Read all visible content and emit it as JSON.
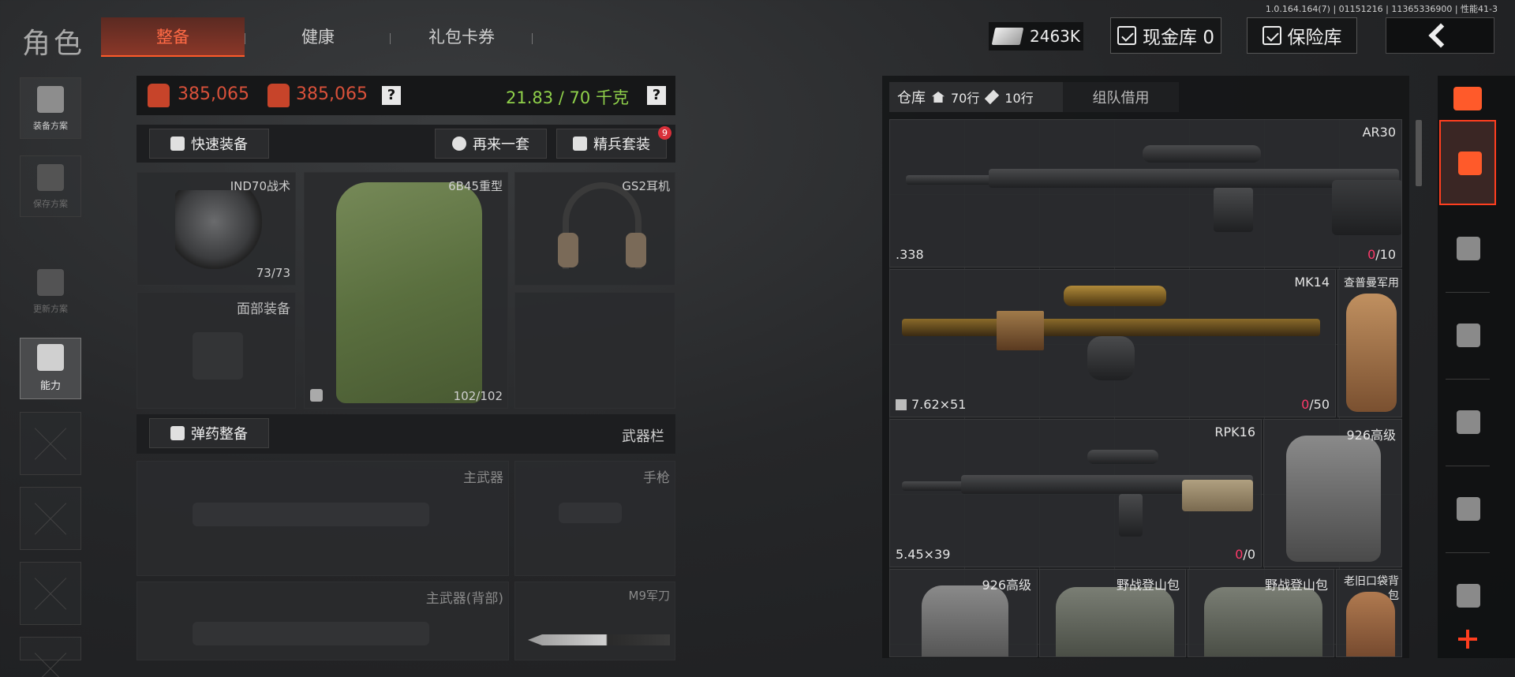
{
  "version": "1.0.164.164(7) | 01151216 | 11365336900 | 性能41-3",
  "page_title": "角色",
  "tabs": [
    {
      "label": "整备",
      "active": true
    },
    {
      "label": "健康",
      "active": false
    },
    {
      "label": "礼包卡券",
      "active": false
    }
  ],
  "currency": {
    "amount": "2463K"
  },
  "top_buttons": {
    "cash_vault": "现金库 0",
    "insurance": "保险库"
  },
  "sidebar": {
    "items": [
      {
        "label": "装备方案",
        "icon": "vest-icon"
      },
      {
        "label": "保存方案",
        "icon": "download-icon"
      },
      {
        "label": "更新方案",
        "icon": "helmet-icon"
      },
      {
        "label": "能力",
        "icon": "lightning-icon"
      }
    ]
  },
  "loadout": {
    "value_1": "385,065",
    "value_2": "385,065",
    "weight": "21.83 / 70 千克",
    "help": "?"
  },
  "actions": {
    "quick_equip": "快速装备",
    "again": "再来一套",
    "elite": "精兵套装",
    "elite_badge": "9",
    "ammo": "弹药整备",
    "weapon_bar": "武器栏"
  },
  "slots": {
    "helmet": {
      "name": "IND70战术",
      "durability": "73/73"
    },
    "armor": {
      "name": "6B45重型",
      "durability": "102/102"
    },
    "headset": {
      "name": "GS2耳机"
    },
    "face": {
      "name": "面部装备"
    },
    "primary": {
      "name": "主武器"
    },
    "pistol": {
      "name": "手枪"
    },
    "primary_back": {
      "name": "主武器(背部)"
    },
    "melee": {
      "name": "M9军刀"
    }
  },
  "warehouse": {
    "tab_label": "仓库",
    "rows_1": "70行",
    "rows_2": "10行",
    "team_tab": "组队借用",
    "items": [
      {
        "name": "AR30",
        "caliber": ".338",
        "ammo_loaded": "0",
        "ammo_total": "/10"
      },
      {
        "name": "MK14",
        "caliber": "7.62×51",
        "ammo_loaded": "0",
        "ammo_total": "/50"
      },
      {
        "name": "查普曼军用"
      },
      {
        "name": "RPK16",
        "caliber": "5.45×39",
        "ammo_loaded": "0",
        "ammo_total": "/0"
      },
      {
        "name": "926高级"
      },
      {
        "name": "926高级"
      },
      {
        "name": "野战登山包"
      },
      {
        "name": "野战登山包"
      },
      {
        "name": "老旧口袋背包"
      }
    ]
  },
  "colors": {
    "accent": "#ff5a2a",
    "value_red": "#d9513a",
    "weight_green": "#8fd04a",
    "ammo_zero": "#ff3a6a"
  }
}
